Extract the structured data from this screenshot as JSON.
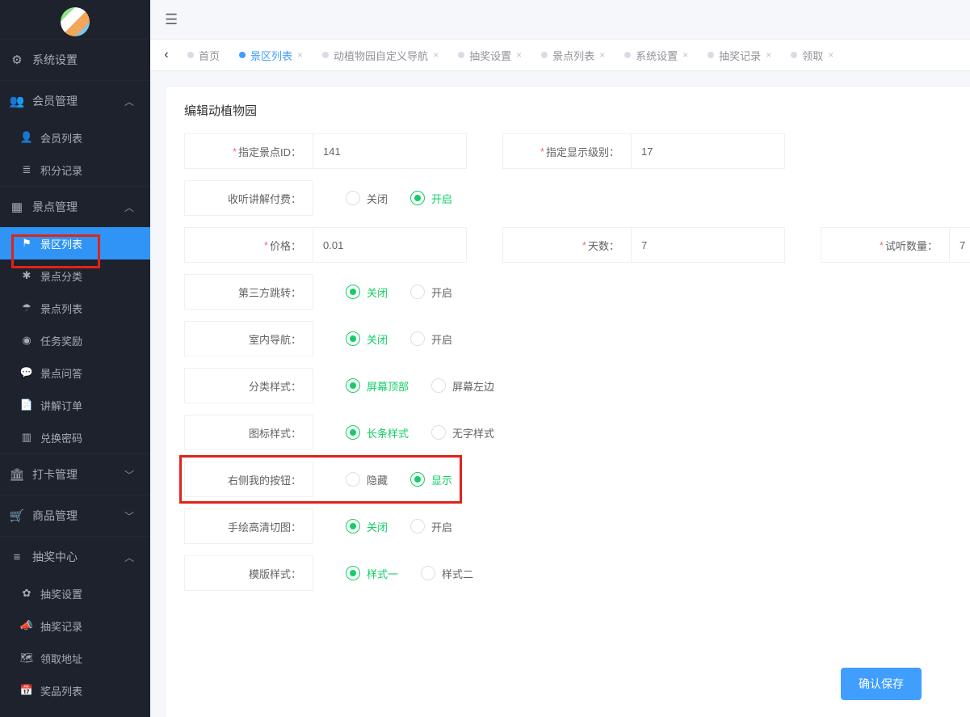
{
  "sidebar": {
    "groups": [
      {
        "icon": "⚙",
        "label": "系统设置",
        "expandable": false
      },
      {
        "icon": "👥",
        "label": "会员管理",
        "expandable": true,
        "expanded": true,
        "items": [
          {
            "icon": "👤",
            "label": "会员列表"
          },
          {
            "icon": "≣",
            "label": "积分记录"
          }
        ]
      },
      {
        "icon": "▦",
        "label": "景点管理",
        "expandable": true,
        "expanded": true,
        "items": [
          {
            "icon": "⚑",
            "label": "景区列表",
            "active": true
          },
          {
            "icon": "✱",
            "label": "景点分类"
          },
          {
            "icon": "☂",
            "label": "景点列表"
          },
          {
            "icon": "◉",
            "label": "任务奖励"
          },
          {
            "icon": "💬",
            "label": "景点问答"
          },
          {
            "icon": "📄",
            "label": "讲解订单"
          },
          {
            "icon": "▥",
            "label": "兑换密码"
          }
        ]
      },
      {
        "icon": "🏛",
        "label": "打卡管理",
        "expandable": true,
        "expanded": false
      },
      {
        "icon": "🛒",
        "label": "商品管理",
        "expandable": true,
        "expanded": false
      },
      {
        "icon": "≡",
        "label": "抽奖中心",
        "expandable": true,
        "expanded": true,
        "items": [
          {
            "icon": "✿",
            "label": "抽奖设置"
          },
          {
            "icon": "📣",
            "label": "抽奖记录"
          },
          {
            "icon": "🗺",
            "label": "领取地址"
          },
          {
            "icon": "📅",
            "label": "奖品列表"
          }
        ]
      }
    ]
  },
  "tabs": [
    {
      "label": "首页",
      "active": false,
      "closable": false
    },
    {
      "label": "景区列表",
      "active": true,
      "closable": true
    },
    {
      "label": "动植物园自定义导航",
      "active": false,
      "closable": true
    },
    {
      "label": "抽奖设置",
      "active": false,
      "closable": true
    },
    {
      "label": "景点列表",
      "active": false,
      "closable": true
    },
    {
      "label": "系统设置",
      "active": false,
      "closable": true
    },
    {
      "label": "抽奖记录",
      "active": false,
      "closable": true
    },
    {
      "label": "领取",
      "active": false,
      "closable": true
    }
  ],
  "panel": {
    "title": "编辑动植物园",
    "save_label": "确认保存",
    "fields": {
      "spot_id": {
        "label": "指定景点ID：",
        "required": true,
        "value": "141"
      },
      "level": {
        "label": "指定显示级别：",
        "required": true,
        "value": "17"
      },
      "listen_pay": {
        "label": "收听讲解付费：",
        "options": [
          "关闭",
          "开启"
        ],
        "selected": 1
      },
      "price": {
        "label": "价格：",
        "required": true,
        "value": "0.01"
      },
      "days": {
        "label": "天数：",
        "required": true,
        "value": "7"
      },
      "trial": {
        "label": "试听数量：",
        "required": true,
        "value": "7"
      },
      "third": {
        "label": "第三方跳转：",
        "options": [
          "关闭",
          "开启"
        ],
        "selected": 0
      },
      "indoor": {
        "label": "室内导航：",
        "options": [
          "关闭",
          "开启"
        ],
        "selected": 0
      },
      "catstyle": {
        "label": "分类样式：",
        "options": [
          "屏幕顶部",
          "屏幕左边"
        ],
        "selected": 0
      },
      "iconstyle": {
        "label": "图标样式：",
        "options": [
          "长条样式",
          "无字样式"
        ],
        "selected": 0
      },
      "rightbtn": {
        "label": "右侧我的按钮：",
        "options": [
          "隐藏",
          "显示"
        ],
        "selected": 1
      },
      "hdmap": {
        "label": "手绘高清切图：",
        "options": [
          "关闭",
          "开启"
        ],
        "selected": 0
      },
      "tplstyle": {
        "label": "模版样式：",
        "options": [
          "样式一",
          "样式二"
        ],
        "selected": 0
      }
    }
  }
}
